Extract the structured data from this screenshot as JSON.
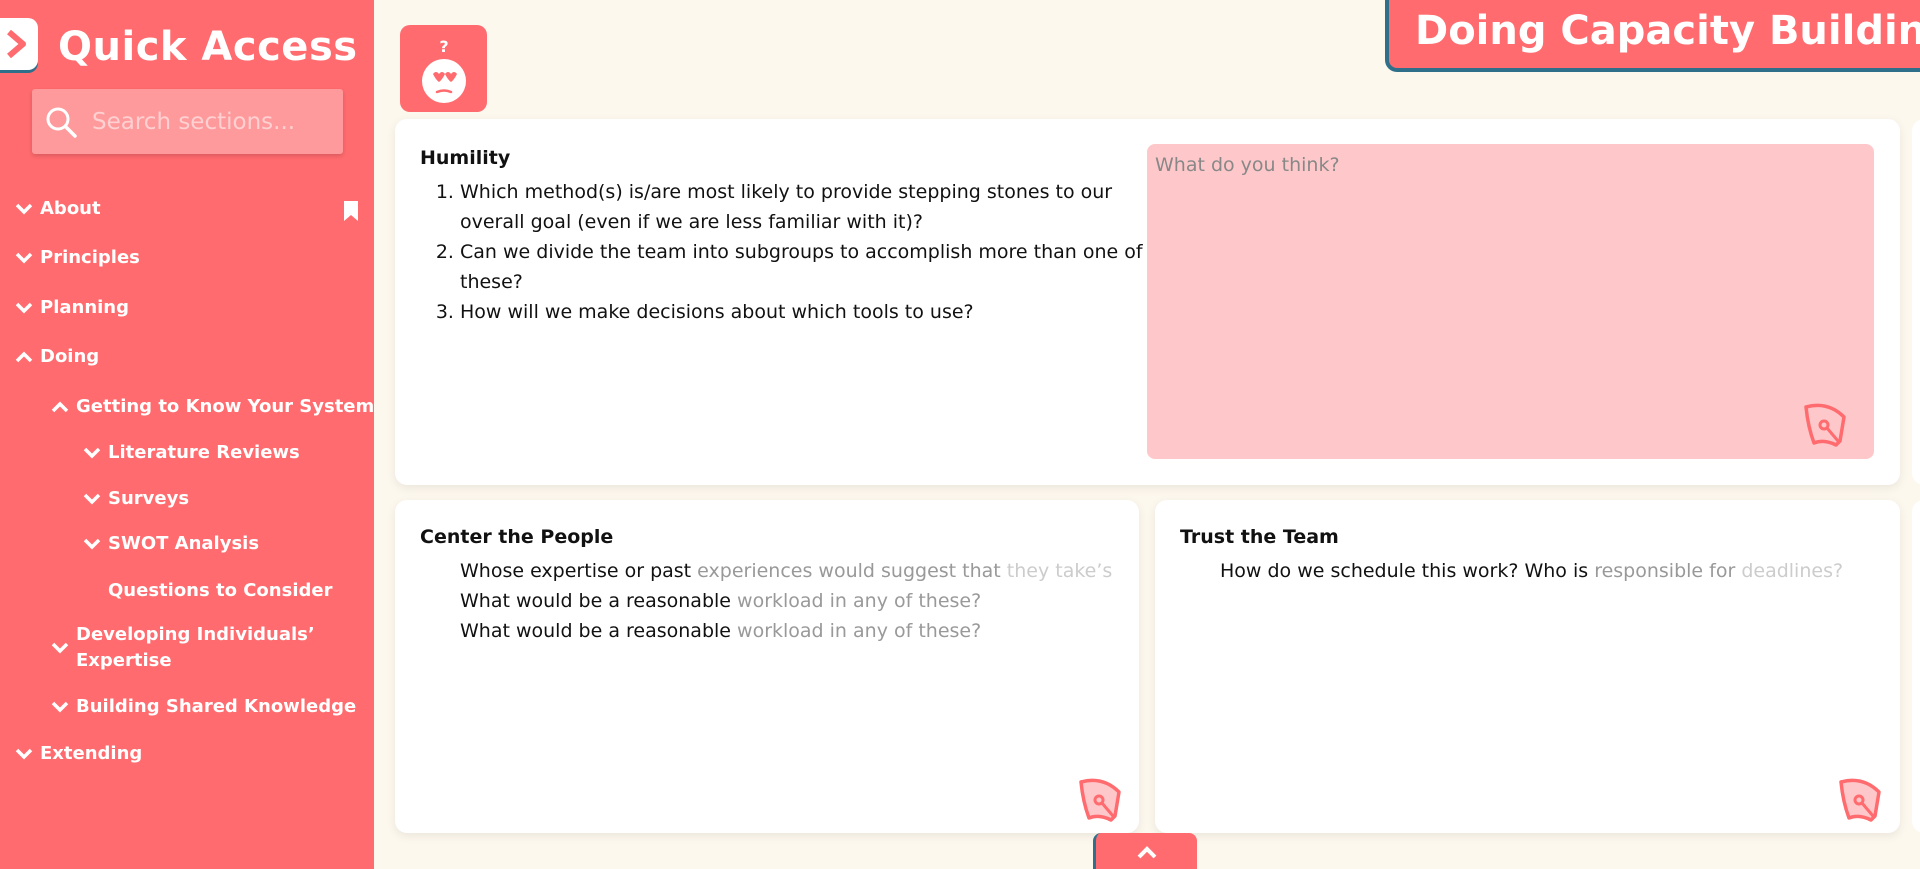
{
  "sidebar": {
    "title": "Quick Access",
    "search_placeholder": "Search sections...",
    "items": [
      {
        "label": "About",
        "state": "collapsed"
      },
      {
        "label": "Principles",
        "state": "collapsed"
      },
      {
        "label": "Planning",
        "state": "collapsed"
      },
      {
        "label": "Doing",
        "state": "expanded"
      },
      {
        "label": "Getting to Know Your System",
        "state": "expanded"
      },
      {
        "label": "Literature Reviews",
        "state": "collapsed"
      },
      {
        "label": "Surveys",
        "state": "collapsed"
      },
      {
        "label": "SWOT Analysis",
        "state": "collapsed"
      },
      {
        "label": "Questions to Consider",
        "state": "leaf"
      },
      {
        "label": "Developing Individuals’",
        "label2": "Expertise",
        "state": "collapsed"
      },
      {
        "label": "Building Shared Knowledge",
        "state": "collapsed"
      },
      {
        "label": "Extending",
        "state": "collapsed"
      }
    ]
  },
  "banner": {
    "title": "Doing Capacity Building"
  },
  "cards": {
    "humility": {
      "title": "Humility",
      "questions": [
        "Which method(s) is/are most likely to provide stepping stones to our overall goal (even if we are less familiar with it)?",
        "Can we divide the team into subgroups to accomplish more than one of these?",
        "How will we make decisions about which tools to use?"
      ],
      "answer_placeholder": "What do you think?"
    },
    "center": {
      "title": "Center the People",
      "q1a": "Whose expertise or past ",
      "q1b": "experiences would suggest that ",
      "q1c": "they take’s",
      "q2a": "What would be a reasonable ",
      "q2b": "workload in any of these?",
      "q3a": "What would be a reasonable ",
      "q3b": "workload in any of these?"
    },
    "trust": {
      "title": "Trust the Team",
      "q1a": "How do we schedule this work? Who is ",
      "q1b": "responsible for ",
      "q1c": "deadlines?"
    }
  },
  "colors": {
    "accent": "#ff6b6e",
    "answer_bg": "#fec8ca",
    "background": "#fdf8ee",
    "border": "#2f6f8a"
  },
  "icons": [
    "chevron-right-icon",
    "search-icon",
    "chevron-down-icon",
    "chevron-up-icon",
    "bookmark-icon",
    "confused-face-icon",
    "pen-nib-icon"
  ]
}
